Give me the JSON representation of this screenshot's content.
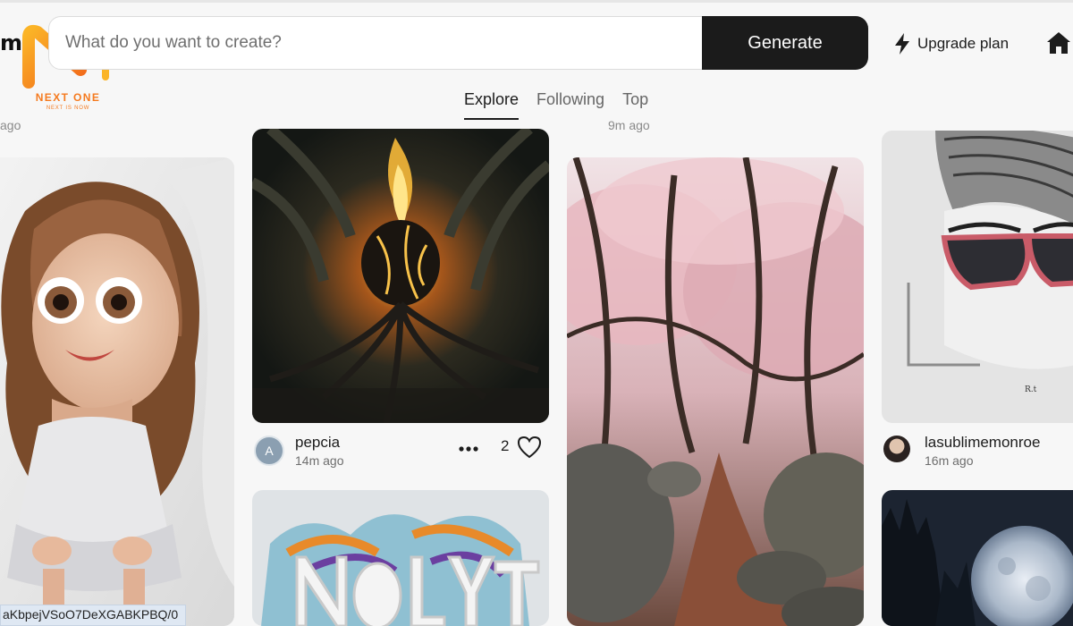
{
  "brand": {
    "letter": "m"
  },
  "watermark": {
    "name": "NEXT ONE",
    "tagline": "NEXT IS NOW",
    "colors": [
      "#f57a1f",
      "#fbb427"
    ]
  },
  "search": {
    "placeholder": "What do you want to create?",
    "value": ""
  },
  "header": {
    "generate_label": "Generate",
    "upgrade_label": "Upgrade plan",
    "upgrade_icon": "lightning-icon",
    "home_icon": "home-icon"
  },
  "tabs": [
    {
      "label": "Explore",
      "active": true
    },
    {
      "label": "Following",
      "active": false
    },
    {
      "label": "Top",
      "active": false
    }
  ],
  "feed": {
    "partial_time_left": "ago",
    "partial_time_center": "9m ago",
    "cards": [
      {
        "user": "pepcia",
        "avatar_letter": "A",
        "time": "14m ago",
        "likes": "2",
        "image": "dark tree roots with glowing cracked egg"
      },
      {
        "user": "lasublimemonroe",
        "time": "16m ago",
        "image": "portrait sketch with pink sunglasses"
      }
    ]
  },
  "status_bar": {
    "url_fragment": "aKbpejVSoO7DeXGABKPBQ/0"
  }
}
